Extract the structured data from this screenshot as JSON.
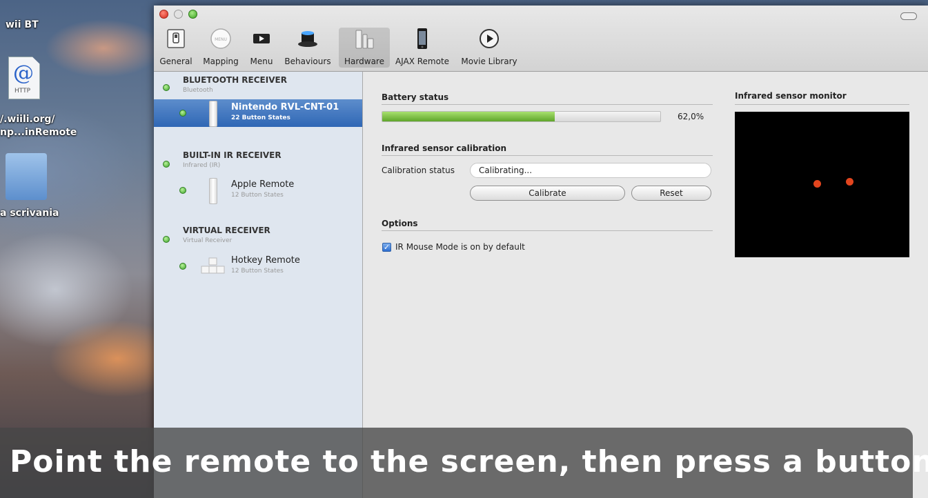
{
  "desktop": {
    "labels": {
      "wii_bt": "wii BT",
      "http_line1": "/.wiili.org/",
      "http_line2": "np...inRemote",
      "folder": "a scrivania",
      "http_tag": "HTTP"
    }
  },
  "toolbar": {
    "items": [
      {
        "label": "General",
        "icon": "switch-icon"
      },
      {
        "label": "Mapping",
        "icon": "menu-button-icon"
      },
      {
        "label": "Menu",
        "icon": "menu-arrow-icon"
      },
      {
        "label": "Behaviours",
        "icon": "magic-hat-icon"
      },
      {
        "label": "Hardware",
        "icon": "hardware-icon",
        "selected": true
      },
      {
        "label": "AJAX Remote",
        "icon": "iphone-icon"
      },
      {
        "label": "Movie Library",
        "icon": "play-icon"
      }
    ],
    "mapping_icon_text": "MENU"
  },
  "sidebar": {
    "groups": [
      {
        "title": "BLUETOOTH RECEIVER",
        "subtitle": "Bluetooth",
        "device": {
          "name": "Nintendo RVL-CNT-01",
          "states": "22 Button States"
        }
      },
      {
        "title": "BUILT-IN IR RECEIVER",
        "subtitle": "Infrared (IR)",
        "device": {
          "name": "Apple Remote",
          "states": "12 Button States"
        }
      },
      {
        "title": "VIRTUAL RECEIVER",
        "subtitle": "Virtual Receiver",
        "device": {
          "name": "Hotkey Remote",
          "states": "12 Button States"
        }
      }
    ]
  },
  "main": {
    "battery": {
      "title": "Battery status",
      "percent_text": "62,0%",
      "level": 0.62
    },
    "calibration": {
      "title": "Infrared sensor calibration",
      "status_label": "Calibration status",
      "status_value": "Calibrating...",
      "calibrate_label": "Calibrate",
      "reset_label": "Reset"
    },
    "options": {
      "title": "Options",
      "ir_mouse_label": "IR Mouse Mode is on by default",
      "ir_mouse_checked": true
    },
    "monitor": {
      "title": "Infrared sensor monitor"
    }
  },
  "subtitle": {
    "text": "Point the remote to the screen, then press a button."
  },
  "colors": {
    "selection": "#3a72bd",
    "battery_fill": "#6fb836",
    "ir_point": "#e2451e",
    "status_dot": "#3ba32a"
  }
}
